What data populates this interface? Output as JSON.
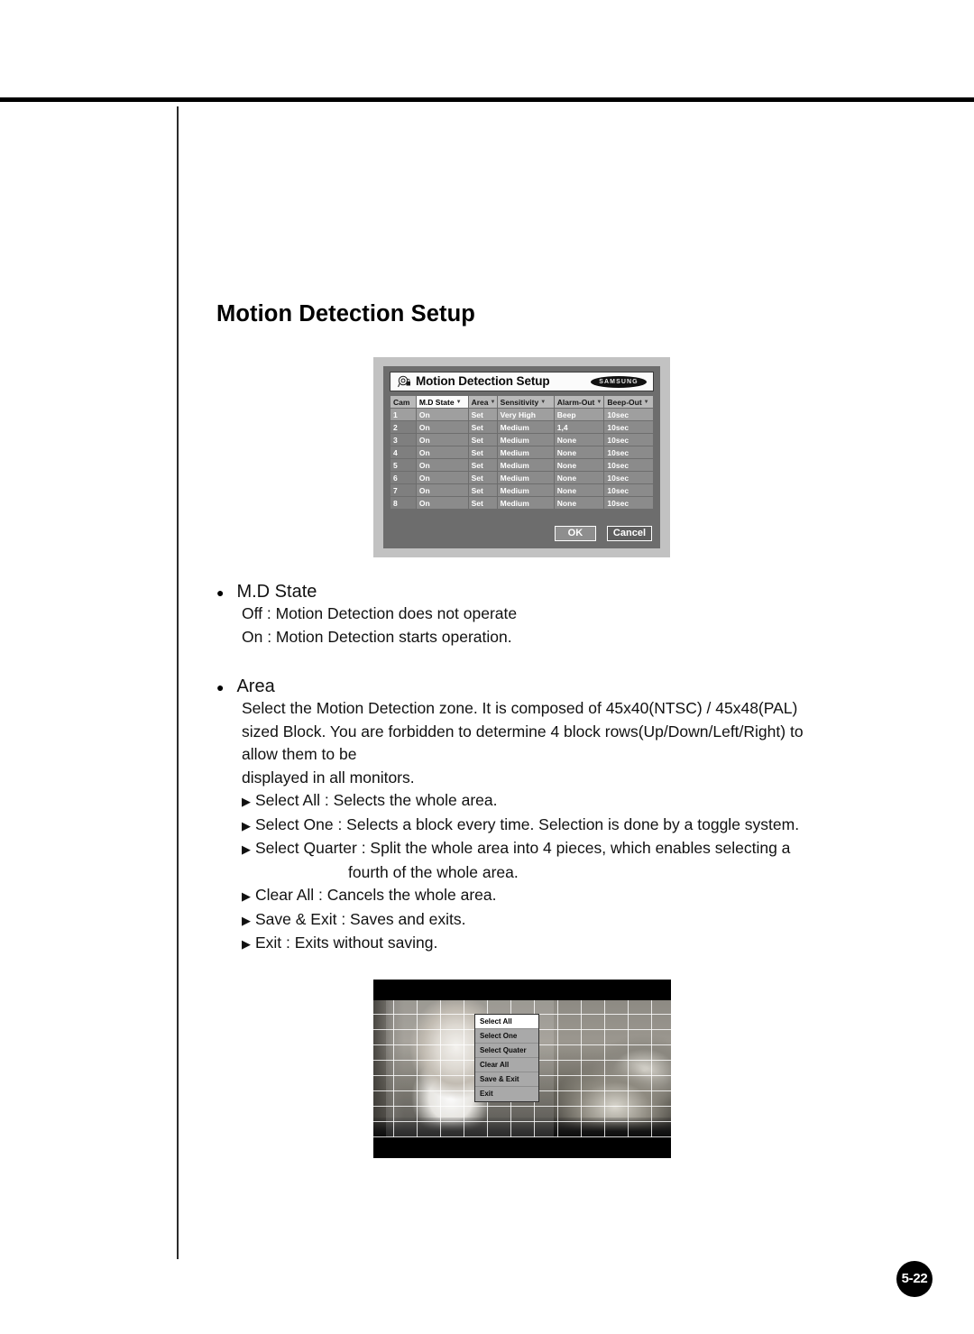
{
  "page": {
    "title": "Motion Detection Setup",
    "number_badge": "5-22"
  },
  "osd_dialog": {
    "title": "Motion Detection Setup",
    "title_icon": "camera-lens-icon",
    "brand": "SAMSUNG",
    "columns": [
      {
        "label": "Cam",
        "has_caret": false
      },
      {
        "label": "M.D State",
        "has_caret": true
      },
      {
        "label": "Area",
        "has_caret": true
      },
      {
        "label": "Sensitivity",
        "has_caret": true
      },
      {
        "label": "Alarm-Out",
        "has_caret": true
      },
      {
        "label": "Beep-Out",
        "has_caret": true
      }
    ],
    "rows": [
      {
        "cam": "1",
        "state": "On",
        "area": "Set",
        "sensitivity": "Very High",
        "alarm_out": "Beep",
        "beep_out": "10sec"
      },
      {
        "cam": "2",
        "state": "On",
        "area": "Set",
        "sensitivity": "Medium",
        "alarm_out": "1,4",
        "beep_out": "10sec"
      },
      {
        "cam": "3",
        "state": "On",
        "area": "Set",
        "sensitivity": "Medium",
        "alarm_out": "None",
        "beep_out": "10sec"
      },
      {
        "cam": "4",
        "state": "On",
        "area": "Set",
        "sensitivity": "Medium",
        "alarm_out": "None",
        "beep_out": "10sec"
      },
      {
        "cam": "5",
        "state": "On",
        "area": "Set",
        "sensitivity": "Medium",
        "alarm_out": "None",
        "beep_out": "10sec"
      },
      {
        "cam": "6",
        "state": "On",
        "area": "Set",
        "sensitivity": "Medium",
        "alarm_out": "None",
        "beep_out": "10sec"
      },
      {
        "cam": "7",
        "state": "On",
        "area": "Set",
        "sensitivity": "Medium",
        "alarm_out": "None",
        "beep_out": "10sec"
      },
      {
        "cam": "8",
        "state": "On",
        "area": "Set",
        "sensitivity": "Medium",
        "alarm_out": "None",
        "beep_out": "10sec"
      }
    ],
    "ok_label": "OK",
    "cancel_label": "Cancel"
  },
  "sections": {
    "md_state": {
      "heading": "M.D State",
      "bullet": "●",
      "lines": [
        "Off : Motion Detection does not operate",
        "On : Motion Detection starts operation."
      ]
    },
    "area": {
      "heading": "Area",
      "bullet": "●",
      "paragraph_lines": [
        "Select the Motion Detection zone. It is composed of 45x40(NTSC) / 45x48(PAL)",
        "sized Block. You are forbidden to determine 4 block rows(Up/Down/Left/Right) to",
        "allow them to be",
        "displayed in all monitors."
      ],
      "arrow": "▶",
      "items": [
        "Select All : Selects the whole area.",
        "Select One : Selects a block every time. Selection is done by a toggle system.",
        "Select Quarter : Split the whole area into 4 pieces, which enables selecting a"
      ],
      "continuation": "fourth of the whole area.",
      "items_after": [
        "Clear All : Cancels the whole area.",
        "Save & Exit : Saves and exits.",
        "Exit : Exits without saving."
      ]
    }
  },
  "photo_osd": {
    "menu_items": [
      {
        "label": "Select All",
        "selected": true
      },
      {
        "label": "Select One",
        "selected": false
      },
      {
        "label": "Select Quater",
        "selected": false
      },
      {
        "label": "Clear All",
        "selected": false
      },
      {
        "label": "Save & Exit",
        "selected": false
      },
      {
        "label": "Exit",
        "selected": false
      }
    ]
  },
  "colors": {
    "rule": "#000000",
    "dialog_bg": "#6d6d6d",
    "dialog_frame": "#c2c2c2",
    "header_cell": "#b9b9b9",
    "data_cell": "#8b8b8b",
    "highlight": "#ffffff",
    "badge": "#000000"
  }
}
